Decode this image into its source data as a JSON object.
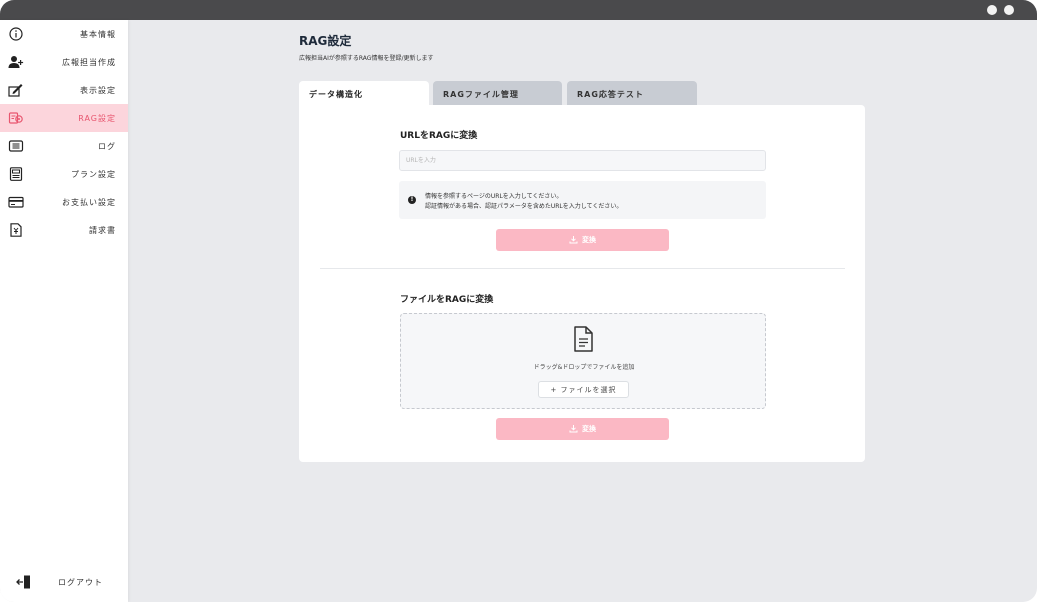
{
  "window": {
    "controls": [
      "dot",
      "dot"
    ]
  },
  "sidebar": {
    "items": [
      {
        "label": "基本情報",
        "icon": "info-circle-icon",
        "active": false
      },
      {
        "label": "広報担当作成",
        "icon": "add-user-icon",
        "active": false
      },
      {
        "label": "表示設定",
        "icon": "edit-icon",
        "active": false
      },
      {
        "label": "RAG設定",
        "icon": "rag-settings-icon",
        "active": true
      },
      {
        "label": "ログ",
        "icon": "log-list-icon",
        "active": false
      },
      {
        "label": "プラン設定",
        "icon": "plan-icon",
        "active": false
      },
      {
        "label": "お支払い設定",
        "icon": "credit-card-icon",
        "active": false
      },
      {
        "label": "請求書",
        "icon": "invoice-icon",
        "active": false
      }
    ],
    "logout": {
      "label": "ログアウト",
      "icon": "logout-icon"
    }
  },
  "page": {
    "title": "RAG設定",
    "subtitle": "広報担当AIが参照するRAG情報を登録/更新します"
  },
  "tabs": [
    {
      "label": "データ構造化",
      "active": true
    },
    {
      "label": "RAGファイル管理",
      "active": false
    },
    {
      "label": "RAG応答テスト",
      "active": false
    }
  ],
  "url_section": {
    "title": "URLをRAGに変換",
    "input_placeholder": "URLを入力",
    "input_value": "",
    "info_line1": "情報を参照するページのURLを入力してください。",
    "info_line2": "認証情報がある場合、認証パラメータを含めたURLを入力してください。",
    "button_label": "変換"
  },
  "file_section": {
    "title": "ファイルをRAGに変換",
    "drop_text": "ドラッグ&ドロップでファイルを追加",
    "select_label": "+ ファイルを選択",
    "button_label": "変換"
  },
  "colors": {
    "accent": "#e8566f",
    "active_bg": "#fcd5dc",
    "button_disabled": "#fbb8c4",
    "titlebar": "#4a4a4c",
    "background": "#e9eaed"
  }
}
